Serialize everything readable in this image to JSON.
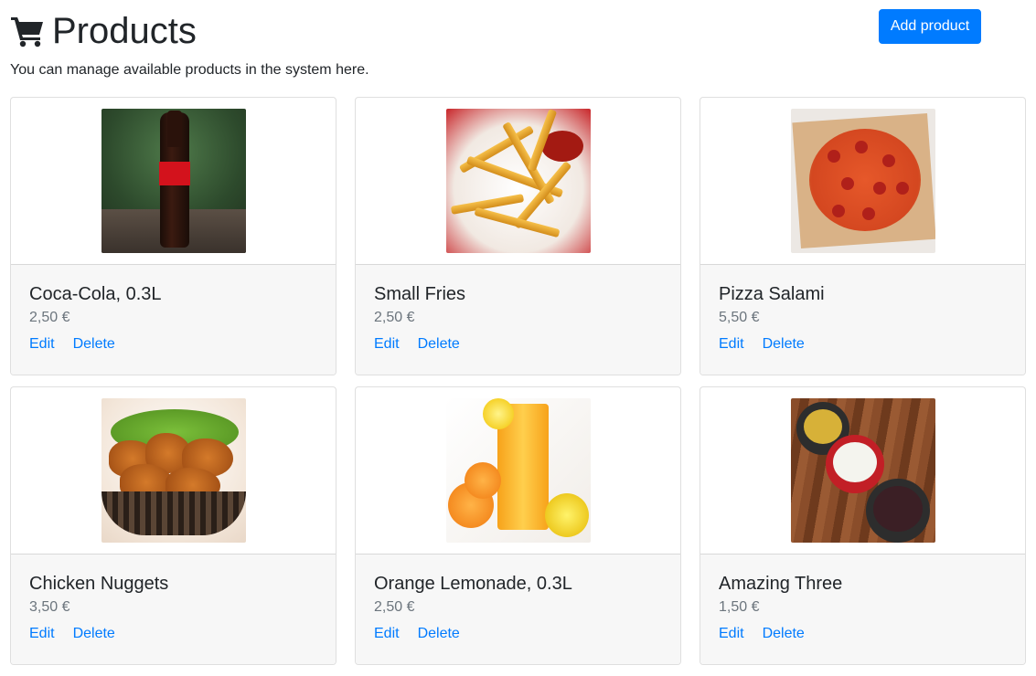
{
  "header": {
    "title": "Products",
    "subtitle": "You can manage available products in the system here.",
    "add_button_label": "Add product",
    "cart_icon": "shopping-cart-icon"
  },
  "colors": {
    "primary": "#007bff",
    "card_body_bg": "#f7f7f7",
    "price_text": "#6c757d"
  },
  "products": [
    {
      "name": "Coca-Cola, 0.3L",
      "price": "2,50 €",
      "edit_label": "Edit",
      "delete_label": "Delete"
    },
    {
      "name": "Small Fries",
      "price": "2,50 €",
      "edit_label": "Edit",
      "delete_label": "Delete"
    },
    {
      "name": "Pizza Salami",
      "price": "5,50 €",
      "edit_label": "Edit",
      "delete_label": "Delete"
    },
    {
      "name": "Chicken Nuggets",
      "price": "3,50 €",
      "edit_label": "Edit",
      "delete_label": "Delete"
    },
    {
      "name": "Orange Lemonade, 0.3L",
      "price": "2,50 €",
      "edit_label": "Edit",
      "delete_label": "Delete"
    },
    {
      "name": "Amazing Three",
      "price": "1,50 €",
      "edit_label": "Edit",
      "delete_label": "Delete"
    }
  ]
}
